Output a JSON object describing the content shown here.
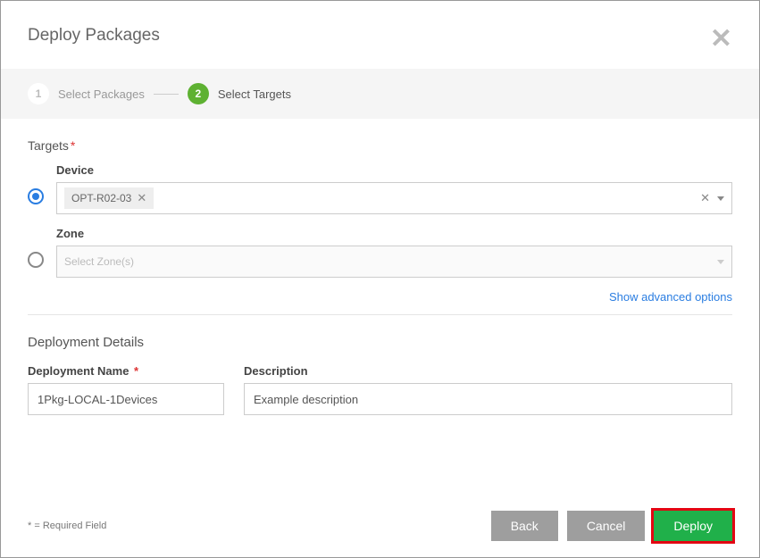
{
  "dialog": {
    "title": "Deploy Packages"
  },
  "stepper": {
    "step1": {
      "num": "1",
      "label": "Select Packages"
    },
    "step2": {
      "num": "2",
      "label": "Select Targets"
    }
  },
  "targets": {
    "heading": "Targets",
    "device": {
      "label": "Device",
      "selected_tag": "OPT-R02-03"
    },
    "zone": {
      "label": "Zone",
      "placeholder": "Select Zone(s)"
    },
    "advanced_link": "Show advanced options"
  },
  "details": {
    "heading": "Deployment Details",
    "name_label": "Deployment Name",
    "name_value": "1Pkg-LOCAL-1Devices",
    "desc_label": "Description",
    "desc_value": "Example description"
  },
  "footer": {
    "required_note": "* = Required Field",
    "back": "Back",
    "cancel": "Cancel",
    "deploy": "Deploy"
  }
}
